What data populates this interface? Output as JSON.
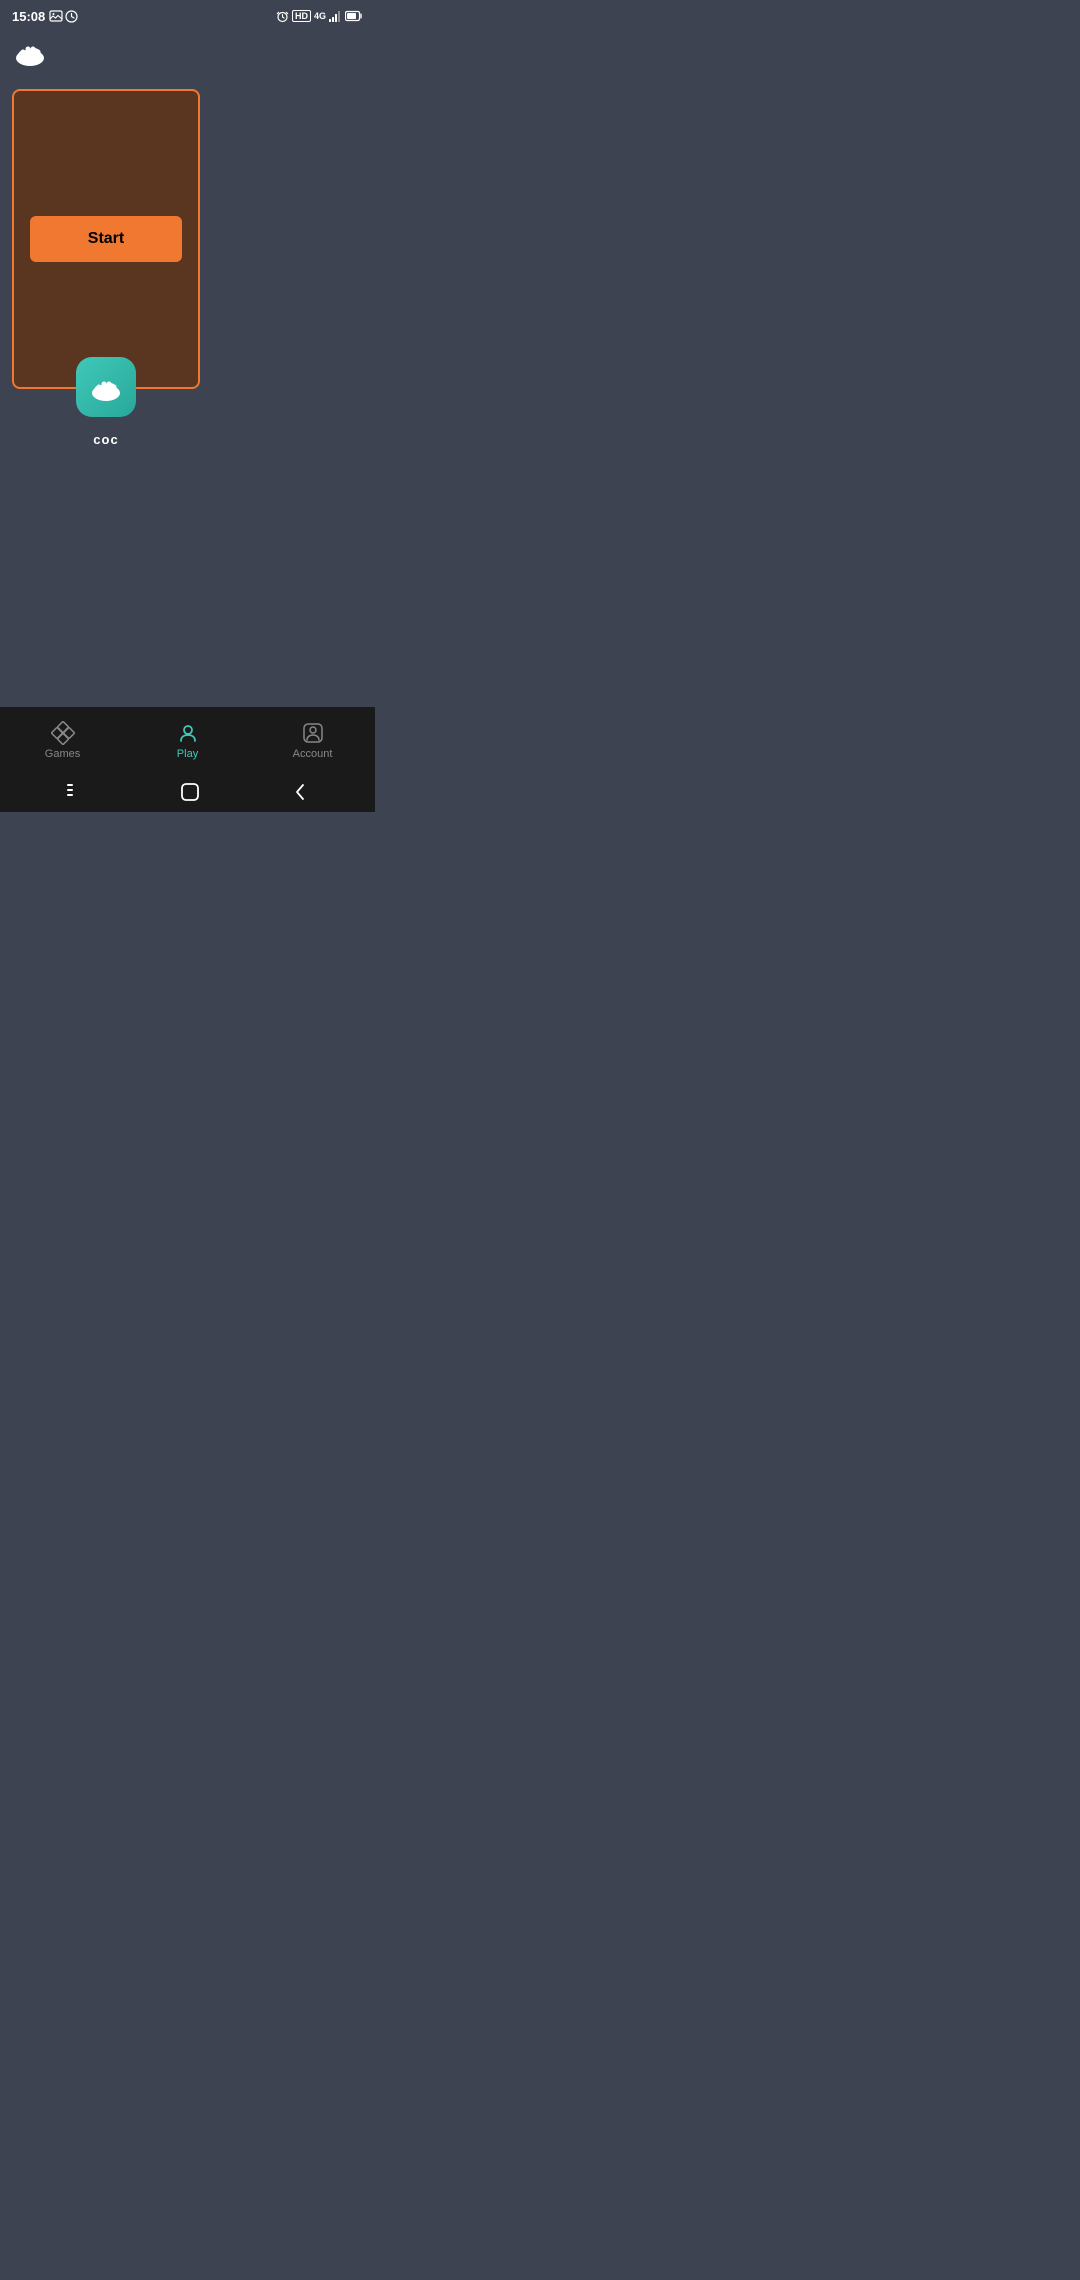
{
  "statusBar": {
    "time": "15:08",
    "rightIcons": [
      "alarm",
      "HD",
      "4G",
      "signal",
      "battery"
    ]
  },
  "appHeader": {
    "iconAlt": "paw-cloud"
  },
  "gameCard": {
    "startButtonLabel": "Start",
    "gameIconAlt": "coc-app-icon",
    "gameLabel": "coc"
  },
  "bottomNav": {
    "items": [
      {
        "label": "Games",
        "icon": "diamond-grid",
        "active": false
      },
      {
        "label": "Play",
        "icon": "person-circle",
        "active": true
      },
      {
        "label": "Account",
        "icon": "person-box",
        "active": false
      }
    ]
  },
  "gestureBar": {
    "buttons": [
      "lines",
      "square",
      "chevron-left"
    ]
  }
}
